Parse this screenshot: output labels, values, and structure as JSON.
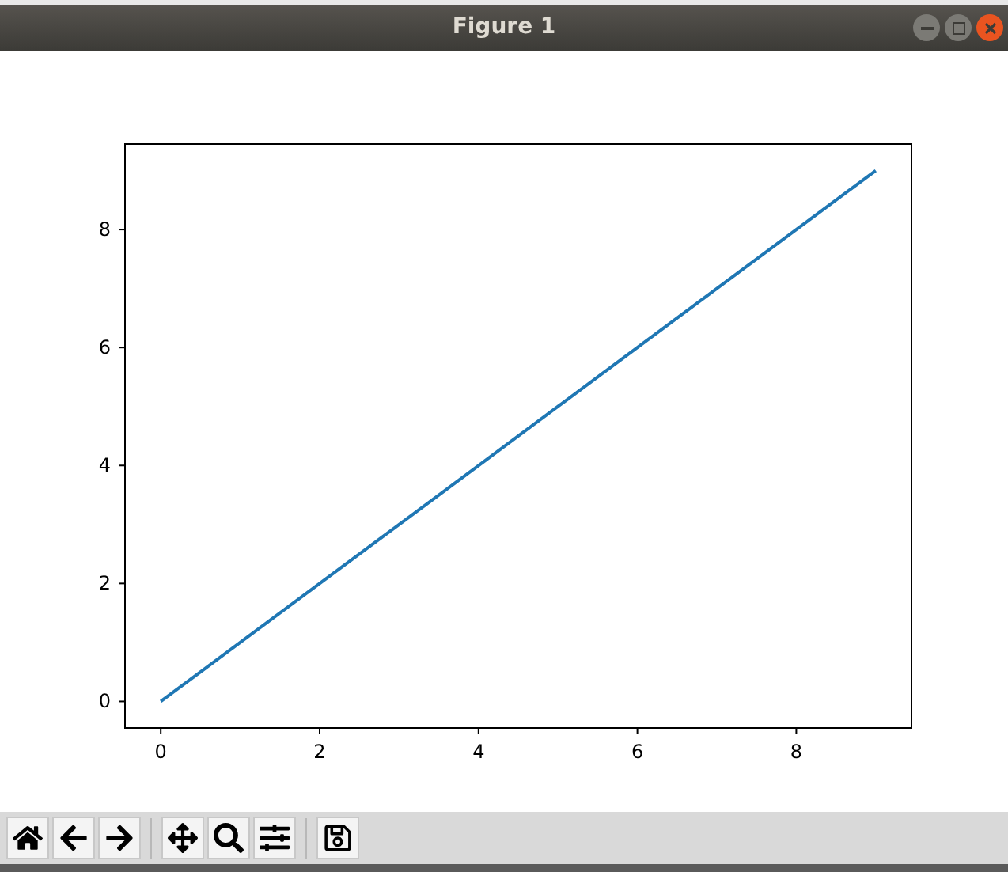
{
  "window": {
    "title": "Figure 1"
  },
  "figure": {
    "chart_data": {
      "type": "line",
      "x": [
        0,
        1,
        2,
        3,
        4,
        5,
        6,
        7,
        8,
        9
      ],
      "series": [
        {
          "color": "#1f77b4",
          "values": [
            0,
            1,
            2,
            3,
            4,
            5,
            6,
            7,
            8,
            9
          ]
        }
      ],
      "xlim": [
        -0.45,
        9.45
      ],
      "ylim": [
        -0.45,
        9.45
      ],
      "xticks": [
        0,
        2,
        4,
        6,
        8
      ],
      "yticks": [
        0,
        2,
        4,
        6,
        8
      ]
    }
  }
}
